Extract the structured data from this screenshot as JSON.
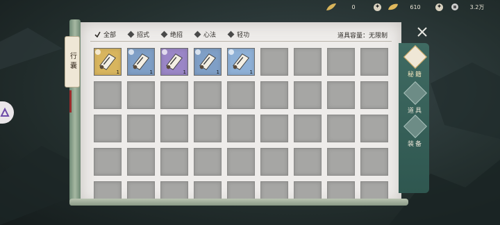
{
  "currencies": [
    {
      "icon": "gold-leaf-icon",
      "value": "0"
    },
    {
      "icon": "gold-ingot-icon",
      "value": "610"
    },
    {
      "icon": "silver-coin-icon",
      "value": "3.2万"
    }
  ],
  "scroll_title": "行囊",
  "filters": [
    {
      "label": "全部",
      "selected": true
    },
    {
      "label": "招式",
      "selected": false
    },
    {
      "label": "绝招",
      "selected": false
    },
    {
      "label": "心法",
      "selected": false
    },
    {
      "label": "轻功",
      "selected": false
    }
  ],
  "capacity_label": "道具容量：无限制",
  "items": [
    {
      "name": "scroll-yellow",
      "color": "#d8b55e",
      "qty": "1"
    },
    {
      "name": "scroll-blue",
      "color": "#7f9fc6",
      "qty": "1"
    },
    {
      "name": "scroll-purple",
      "color": "#9a86c6",
      "qty": "1"
    },
    {
      "name": "scroll-blue-2",
      "color": "#7f9fc6",
      "qty": "1"
    },
    {
      "name": "scroll-blue-3",
      "color": "#8eb0d6",
      "qty": "1"
    }
  ],
  "grid": {
    "columns": 9,
    "rows": 5
  },
  "side_tabs": [
    {
      "label": "秘籍",
      "icon": "books-icon",
      "active": true
    },
    {
      "label": "道具",
      "icon": "pouch-icon",
      "active": false
    },
    {
      "label": "装备",
      "icon": "armor-icon",
      "active": false
    }
  ]
}
